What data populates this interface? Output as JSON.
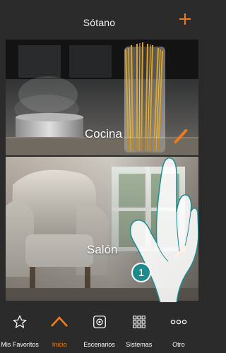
{
  "header": {
    "title": "Sótano",
    "add_icon": "plus-icon"
  },
  "rooms": [
    {
      "label": "Cocina"
    },
    {
      "label": "Salón"
    }
  ],
  "step_badge": "1",
  "tabs": [
    {
      "label": "Mis Favoritos",
      "icon": "star-icon"
    },
    {
      "label": "Inicio",
      "icon": "home-icon"
    },
    {
      "label": "Escenarios",
      "icon": "scenario-icon"
    },
    {
      "label": "Sistemas",
      "icon": "grid-icon"
    },
    {
      "label": "Otro",
      "icon": "more-icon"
    }
  ],
  "colors": {
    "accent": "#f07a1a",
    "bar": "#2b2b2b",
    "badge": "#1f8a8e"
  }
}
